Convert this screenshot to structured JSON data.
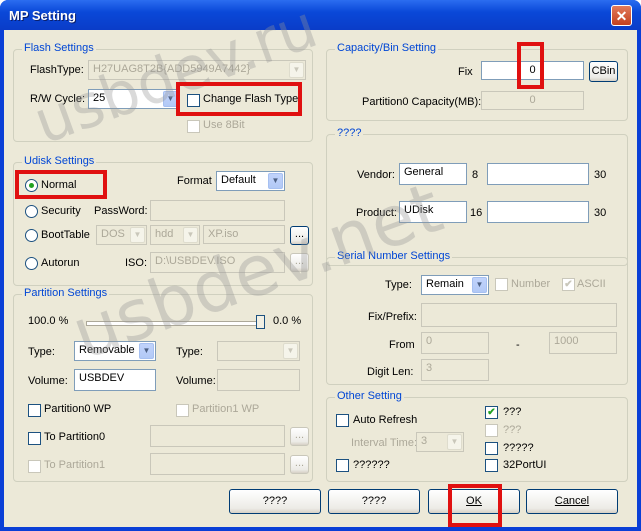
{
  "window": {
    "title": "MP Setting",
    "close_glyph": "✕"
  },
  "watermarks": [
    "usbdev.ru",
    "usbdev.net"
  ],
  "flash": {
    "group_label": "Flash Settings",
    "flash_type_label": "FlashType:",
    "flash_type_value": "H27UAG8T2B{ADD5949A7442}",
    "rw_cycle_label": "R/W Cycle:",
    "rw_cycle_value": "25",
    "change_flash_type_label": "Change Flash Type",
    "use_8bit_label": "Use 8Bit"
  },
  "capacity": {
    "group_label": "Capacity/Bin Setting",
    "fix_label": "Fix",
    "fix_value": "0",
    "cbin_label": "CBin",
    "partition0_label": "Partition0 Capacity(MB):",
    "partition0_value": "0"
  },
  "udisk": {
    "group_label": "Udisk Settings",
    "format_label": "Format",
    "format_value": "Default",
    "normal_label": "Normal",
    "security_label": "Security",
    "password_label": "PassWord:",
    "boottable_label": "BootTable",
    "boot_dos": "DOS",
    "boot_hdd": "hdd",
    "boot_iso": "XP.iso",
    "autorun_label": "Autorun",
    "iso_label": "ISO:",
    "iso_value": "D:\\USBDEV.ISO",
    "browse": "..."
  },
  "vendor_group": {
    "group_label": "????",
    "vendor_label": "Vendor:",
    "vendor_value": "General",
    "vendor_len": "8",
    "vendor_max": "30",
    "product_label": "Product:",
    "product_value": "UDisk",
    "product_len": "16",
    "product_max": "30"
  },
  "partition": {
    "group_label": "Partition Settings",
    "left_percent": "100.0 %",
    "right_percent": "0.0 %",
    "split_fraction": 1.0,
    "type_label": "Type:",
    "type_value": "Removable",
    "type2_label": "Type:",
    "volume_label": "Volume:",
    "volume_value": "USBDEV",
    "volume2_label": "Volume:",
    "p0wp_label": "Partition0 WP",
    "p1wp_label": "Partition1 WP",
    "to_p0_label": "To Partition0",
    "to_p1_label": "To Partition1"
  },
  "serial": {
    "group_label": "Serial Number Settings",
    "type_label": "Type:",
    "type_value": "Remain",
    "number_label": "Number",
    "ascii_label": "ASCII",
    "fix_prefix_label": "Fix/Prefix:",
    "from_label": "From",
    "from_value": "0",
    "dash": "-",
    "to_value": "1000",
    "digit_len_label": "Digit Len:",
    "digit_len_value": "3"
  },
  "other": {
    "group_label": "Other Setting",
    "auto_refresh_label": "Auto Refresh",
    "interval_label": "Interval Time:",
    "interval_value": "3",
    "q6_label": "??????",
    "q3a_label": "???",
    "q3b_label": "???",
    "q5_label": "?????",
    "port32_label": "32PortUI"
  },
  "buttons": {
    "b1": "????",
    "b2": "????",
    "ok": "OK",
    "cancel": "Cancel"
  }
}
